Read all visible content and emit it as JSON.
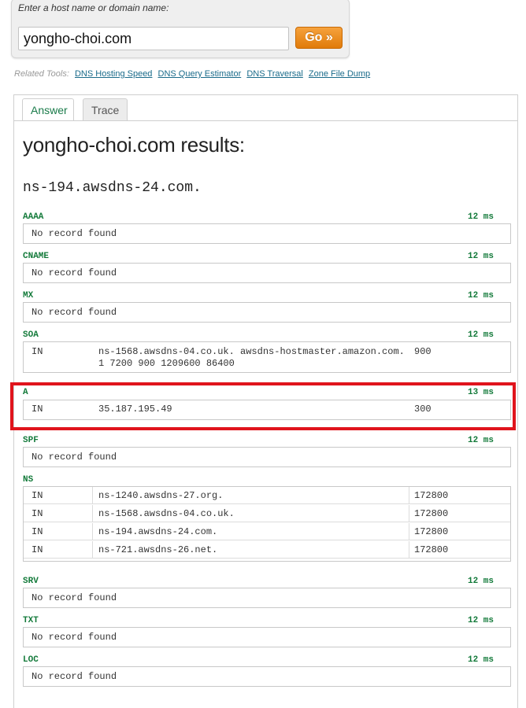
{
  "search": {
    "label": "Enter a host name or domain name:",
    "value": "yongho-choi.com",
    "go_label": "Go »"
  },
  "related": {
    "label": "Related Tools:",
    "links": [
      "DNS Hosting Speed",
      "DNS Query Estimator",
      "DNS Traversal",
      "Zone File Dump"
    ]
  },
  "tabs": [
    "Answer",
    "Trace"
  ],
  "results": {
    "title": "yongho-choi.com results:",
    "nameserver": "ns-194.awsdns-24.com.",
    "no_record": "No record found"
  },
  "records": {
    "aaaa": {
      "type": "AAAA",
      "time": "12 ms"
    },
    "cname": {
      "type": "CNAME",
      "time": "12 ms"
    },
    "mx": {
      "type": "MX",
      "time": "12 ms"
    },
    "soa": {
      "type": "SOA",
      "time": "12 ms",
      "class": "IN",
      "data": "ns-1568.awsdns-04.co.uk. awsdns-hostmaster.amazon.com. 1 7200 900 1209600 86400",
      "ttl": "900"
    },
    "a": {
      "type": "A",
      "time": "13 ms",
      "class": "IN",
      "data": "35.187.195.49",
      "ttl": "300"
    },
    "spf": {
      "type": "SPF",
      "time": "12 ms"
    },
    "ns": {
      "type": "NS",
      "rows": [
        {
          "class": "IN",
          "data": "ns-1240.awsdns-27.org.",
          "ttl": "172800"
        },
        {
          "class": "IN",
          "data": "ns-1568.awsdns-04.co.uk.",
          "ttl": "172800"
        },
        {
          "class": "IN",
          "data": "ns-194.awsdns-24.com.",
          "ttl": "172800"
        },
        {
          "class": "IN",
          "data": "ns-721.awsdns-26.net.",
          "ttl": "172800"
        }
      ]
    },
    "srv": {
      "type": "SRV",
      "time": "12 ms"
    },
    "txt": {
      "type": "TXT",
      "time": "12 ms"
    },
    "loc": {
      "type": "LOC",
      "time": "12 ms"
    }
  },
  "colors": {
    "highlight": "#e0141c",
    "record_type": "#137a3a",
    "go_button": "#e07b0a"
  }
}
